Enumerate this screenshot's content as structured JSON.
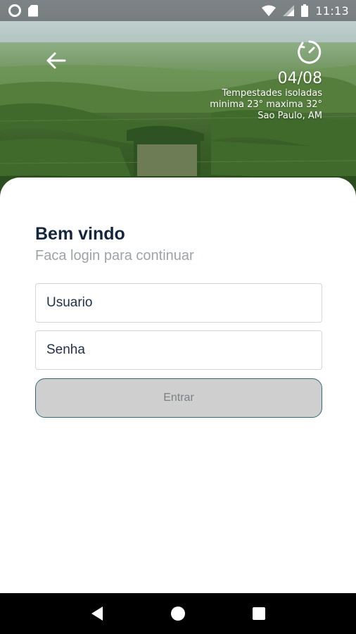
{
  "status_bar": {
    "time": "11:13",
    "icons": [
      "circle-icon",
      "sd-card-icon",
      "wifi-icon",
      "signal-icon",
      "battery-icon"
    ]
  },
  "header": {
    "back_icon": "arrow-left-icon",
    "weather": {
      "icon": "weather-dial-icon",
      "date": "04/08",
      "condition": "Tempestades isoladas",
      "temps": "minima 23° maxima 32°",
      "location": "Sao Paulo, AM"
    }
  },
  "login": {
    "title": "Bem vindo",
    "subtitle": "Faca login para continuar",
    "username_placeholder": "Usuario",
    "password_placeholder": "Senha",
    "submit_label": "Entrar"
  },
  "nav_bar": {
    "buttons": [
      "back-triangle-icon",
      "home-circle-icon",
      "recents-square-icon"
    ]
  },
  "colors": {
    "title": "#13263d",
    "subtitle": "#9ea3a8",
    "button_bg": "#cfcfcf",
    "button_border": "#2f6b78",
    "button_text": "#7c7f83"
  }
}
